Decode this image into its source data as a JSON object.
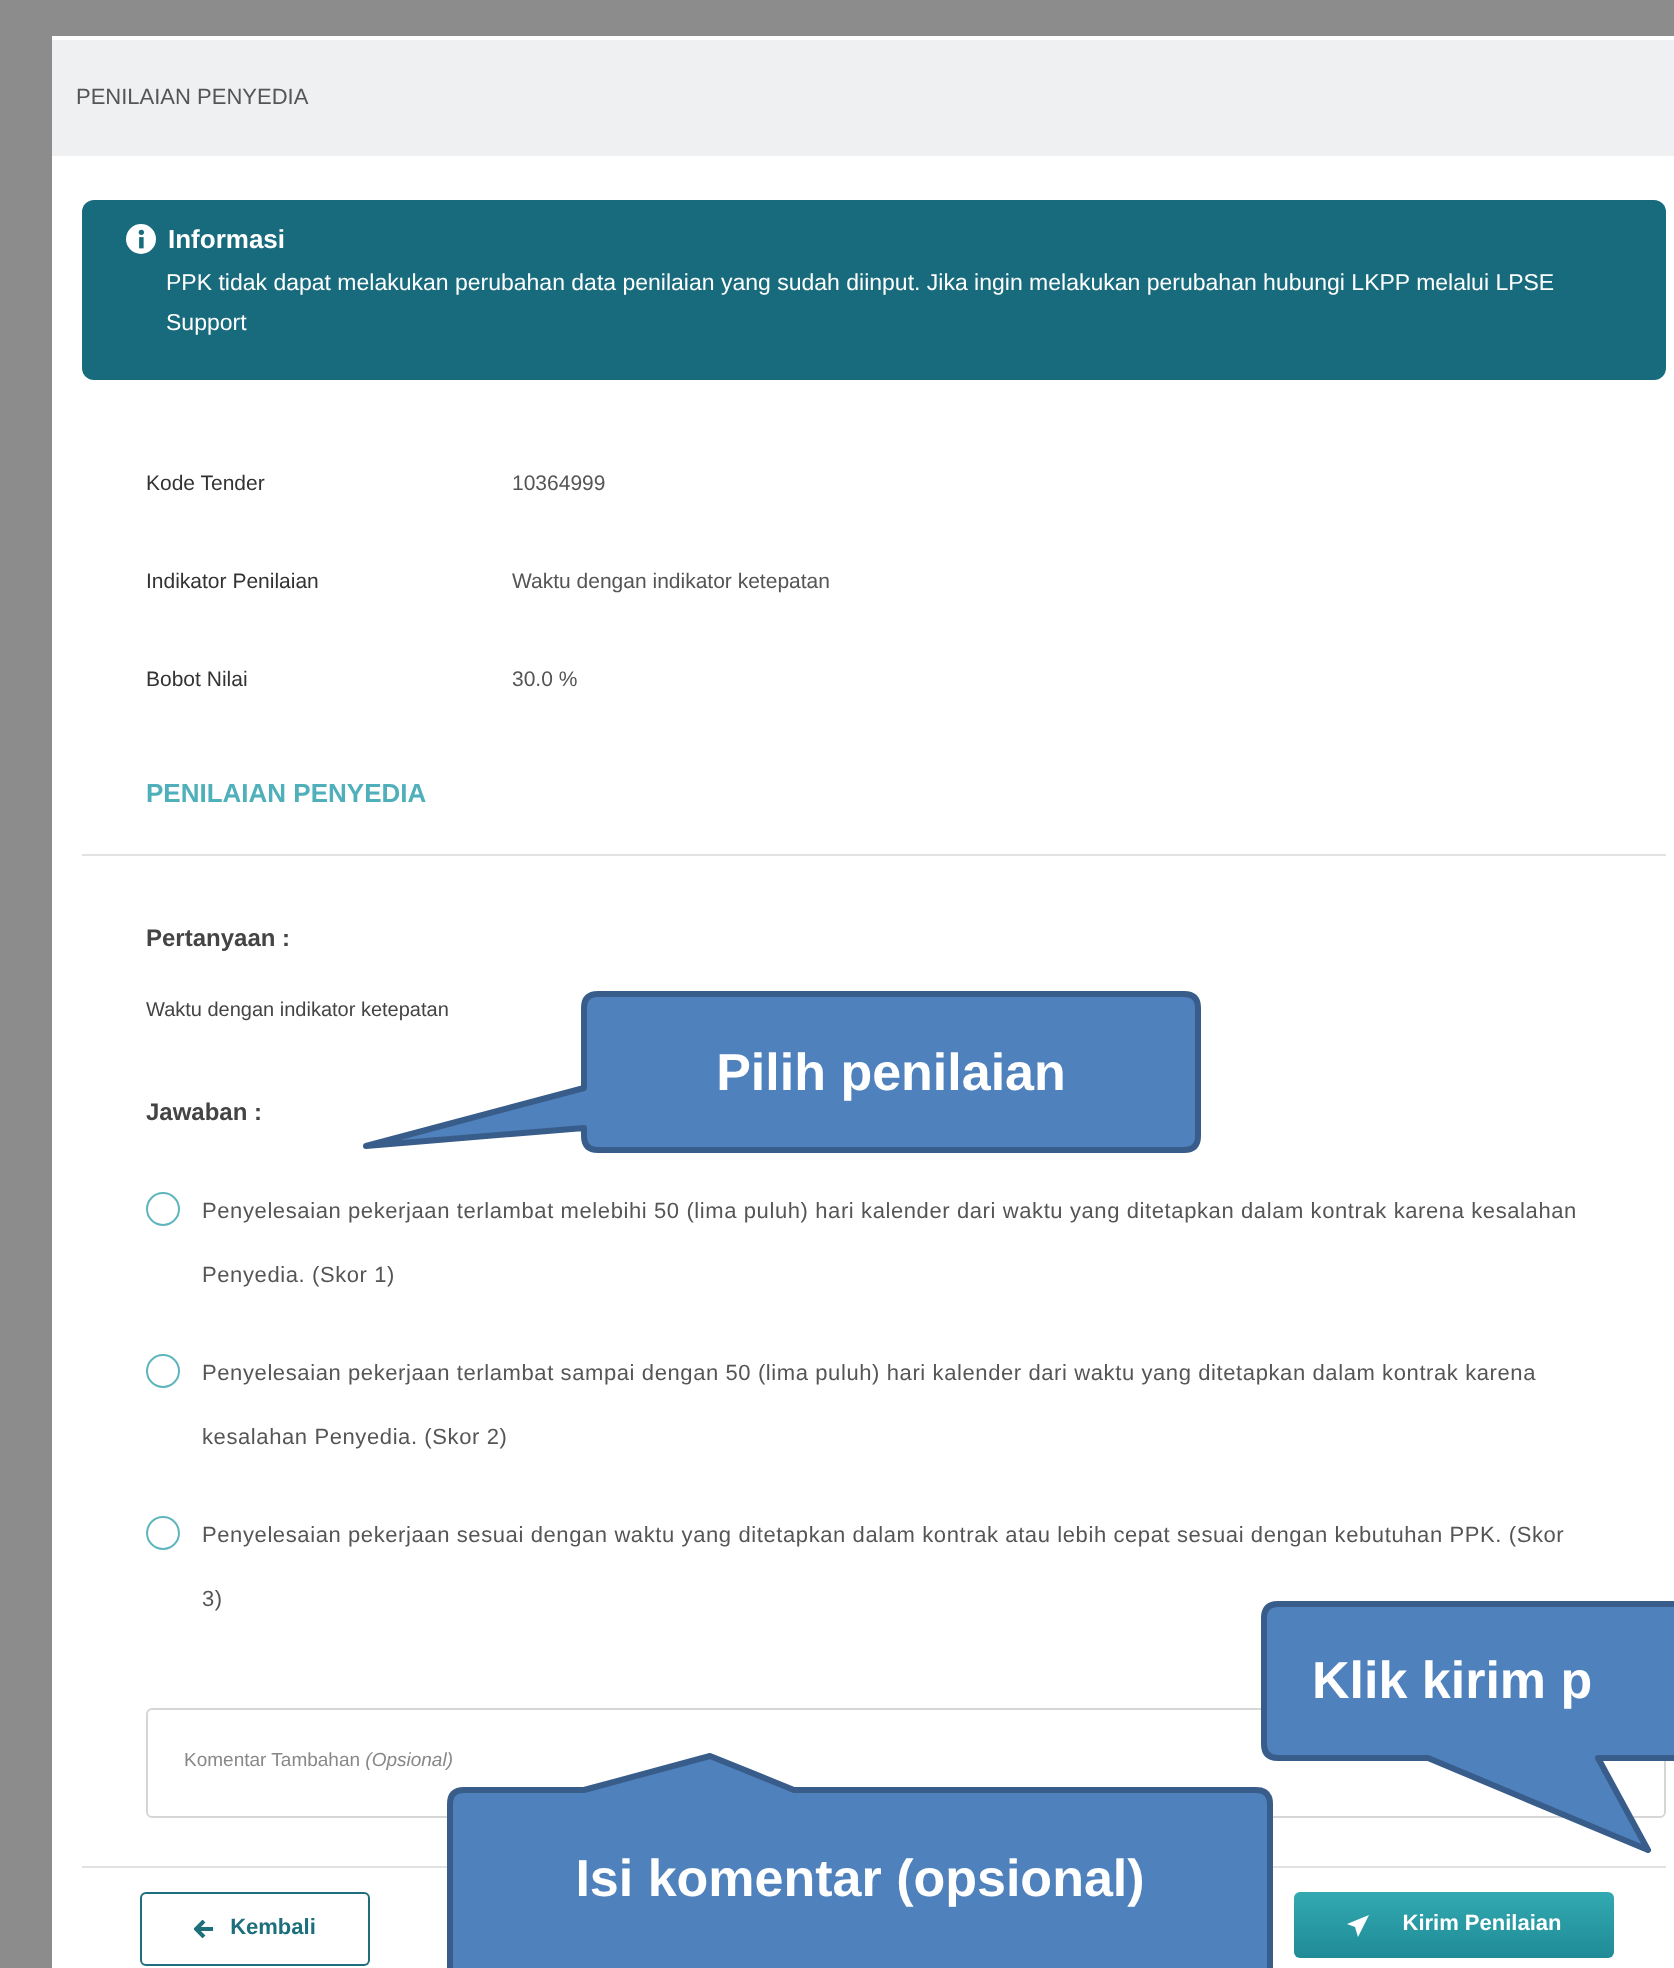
{
  "header": {
    "title": "PENILAIAN PENYEDIA"
  },
  "info": {
    "title": "Informasi",
    "message": "PPK tidak dapat melakukan perubahan data penilaian yang sudah diinput. Jika ingin melakukan perubahan hubungi LKPP melalui LPSE Support"
  },
  "details": [
    {
      "label": "Kode Tender",
      "value": "10364999"
    },
    {
      "label": "Indikator Penilaian",
      "value": "Waktu dengan indikator ketepatan"
    },
    {
      "label": "Bobot Nilai",
      "value": "30.0 %"
    }
  ],
  "section_title": "PENILAIAN PENYEDIA",
  "question": {
    "label": "Pertanyaan :",
    "text": "Waktu dengan indikator ketepatan"
  },
  "answer": {
    "label": "Jawaban :",
    "options": [
      {
        "text": "Penyelesaian pekerjaan terlambat melebihi 50 (lima puluh) hari kalender dari waktu yang ditetapkan dalam kontrak karena kesalahan Penyedia. (Skor 1)",
        "selected": false
      },
      {
        "text": "Penyelesaian pekerjaan terlambat sampai dengan 50 (lima puluh) hari kalender dari waktu yang ditetapkan dalam kontrak karena kesalahan Penyedia. (Skor 2)",
        "selected": false
      },
      {
        "text": "Penyelesaian pekerjaan sesuai dengan waktu yang ditetapkan dalam kontrak atau lebih cepat sesuai dengan kebutuhan PPK. (Skor 3)",
        "selected": false
      }
    ]
  },
  "comment": {
    "placeholder": "Komentar Tambahan *(Opsional)*"
  },
  "buttons": [
    {
      "kind": "back",
      "label": "Kembali"
    },
    {
      "kind": "submit",
      "label": "Kirim Penilaian"
    }
  ],
  "callouts": [
    {
      "text": "Pilih penilaian"
    },
    {
      "text": "Klik kirim p"
    },
    {
      "text": "Isi komentar (opsional)"
    }
  ]
}
